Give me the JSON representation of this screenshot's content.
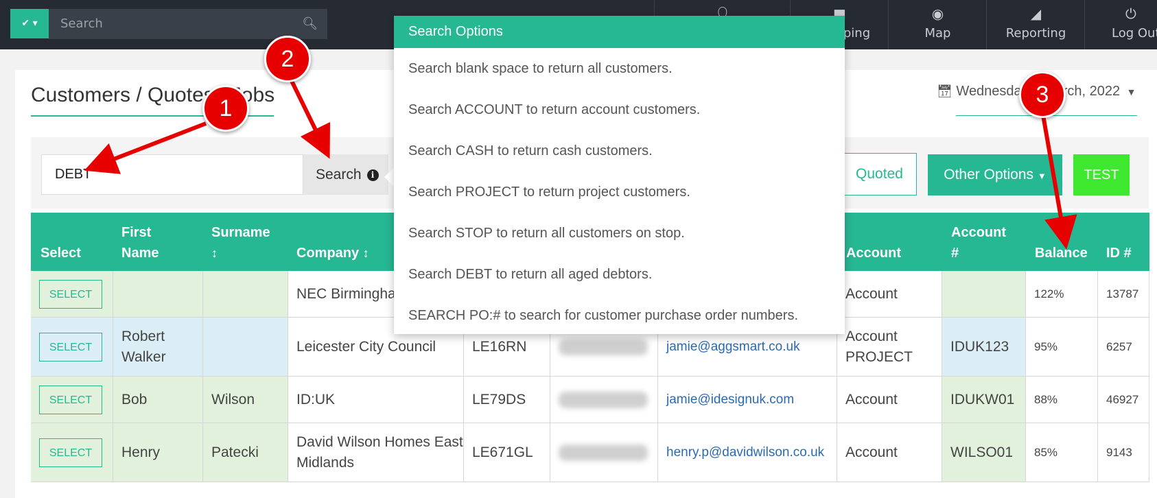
{
  "topbar": {
    "search_placeholder": "Search",
    "nav": [
      {
        "label": "",
        "icon": "person-icon"
      },
      {
        "label": "ping",
        "icon": "truck-icon"
      },
      {
        "label": "Map",
        "icon": "map-pin-icon"
      },
      {
        "label": "Reporting",
        "icon": "chart-icon"
      },
      {
        "label": "Log Out",
        "icon": "power-icon"
      }
    ]
  },
  "page": {
    "title": "Customers / Quotes / Jobs",
    "date": "Wednesday 2 March, 2022"
  },
  "toolbar": {
    "search_value": "DEBT",
    "search_button": "Search",
    "quoted_button": "Quoted",
    "other_options_button": "Other Options",
    "test_button": "TEST"
  },
  "dropdown": {
    "title": "Search Options",
    "items": [
      "Search blank space to return all customers.",
      "Search ACCOUNT to return account customers.",
      "Search CASH to return cash customers.",
      "Search PROJECT to return project customers.",
      "Search STOP to return all customers on stop.",
      "Search DEBT to return all aged debtors.",
      "SEARCH PO:# to search for customer purchase order numbers."
    ]
  },
  "table": {
    "headers": {
      "select": "Select",
      "first_name": [
        "First",
        "Name"
      ],
      "surname": "Surname",
      "company": "Company",
      "account": "Account",
      "account_no": [
        "Account",
        "#"
      ],
      "balance": "Balance",
      "id": "ID #"
    },
    "select_label": "SELECT",
    "rows": [
      {
        "first": "",
        "surname": "",
        "company": "NEC Birmingham",
        "postcode": "",
        "email": "",
        "account": "Account",
        "account_no": "",
        "balance": "122%",
        "id": "13787"
      },
      {
        "first": "Robert Walker",
        "surname": "",
        "company": "Leicester City Council",
        "postcode": "LE16RN",
        "email": "jamie@aggsmart.co.uk",
        "account": "Account PROJECT",
        "account_no": "IDUK123",
        "balance": "95%",
        "id": "6257"
      },
      {
        "first": "Bob",
        "surname": "Wilson",
        "company": "ID:UK",
        "postcode": "LE79DS",
        "email": "jamie@idesignuk.com",
        "account": "Account",
        "account_no": "IDUKW01",
        "balance": "88%",
        "id": "46927"
      },
      {
        "first": "Henry",
        "surname": "Patecki",
        "company": "David Wilson Homes East Midlands",
        "postcode": "LE671GL",
        "email": "henry.p@davidwilson.co.uk",
        "account": "Account",
        "account_no": "WILSO01",
        "balance": "85%",
        "id": "9143"
      }
    ]
  },
  "markers": [
    "1",
    "2",
    "3"
  ],
  "colors": {
    "accent": "#26b793",
    "test": "#3ee82e",
    "marker": "#e60000",
    "topbar": "#262b33"
  }
}
